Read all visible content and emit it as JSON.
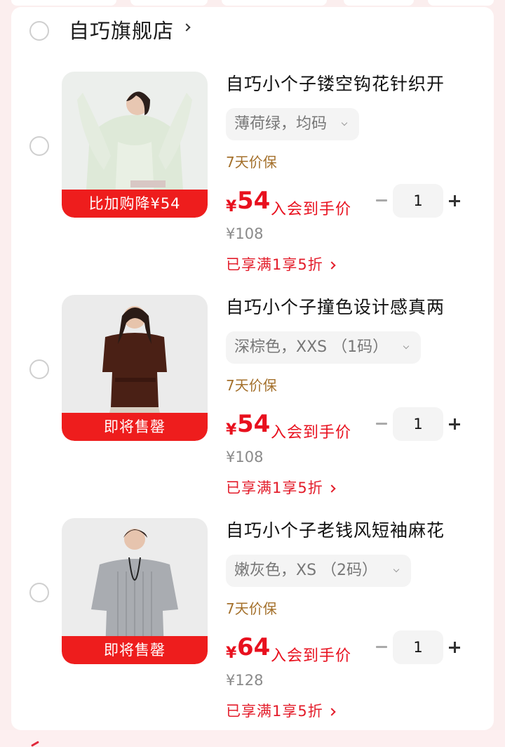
{
  "store": {
    "name": "自巧旗舰店"
  },
  "items": [
    {
      "title": "自巧小个子镂空钩花针织开",
      "sku": "薄荷绿，均码",
      "guarantee": "7天价保",
      "price_symbol": "¥",
      "price": "54",
      "price_note": "入会到手价",
      "original_price": "¥108",
      "discount": "已享满1享5折",
      "promo": "比加购降¥54",
      "quantity": "1"
    },
    {
      "title": "自巧小个子撞色设计感真两",
      "sku": "深棕色，XXS （1码）",
      "guarantee": "7天价保",
      "price_symbol": "¥",
      "price": "54",
      "price_note": "入会到手价",
      "original_price": "¥108",
      "discount": "已享满1享5折",
      "promo": "即将售罄",
      "quantity": "1"
    },
    {
      "title": "自巧小个子老钱风短袖麻花",
      "sku": "嫩灰色，XS （2码）",
      "guarantee": "7天价保",
      "price_symbol": "¥",
      "price": "64",
      "price_note": "入会到手价",
      "original_price": "¥128",
      "discount": "已享满1享5折",
      "promo": "即将售罄",
      "quantity": "1"
    }
  ],
  "colors": {
    "price_red": "#e8101e",
    "promo_red": "#ee1d1d",
    "guarantee_gold": "#a4702b"
  },
  "icons": [
    "radio-icon",
    "chevron-right-icon",
    "chevron-down-icon",
    "minus-icon",
    "plus-icon"
  ]
}
